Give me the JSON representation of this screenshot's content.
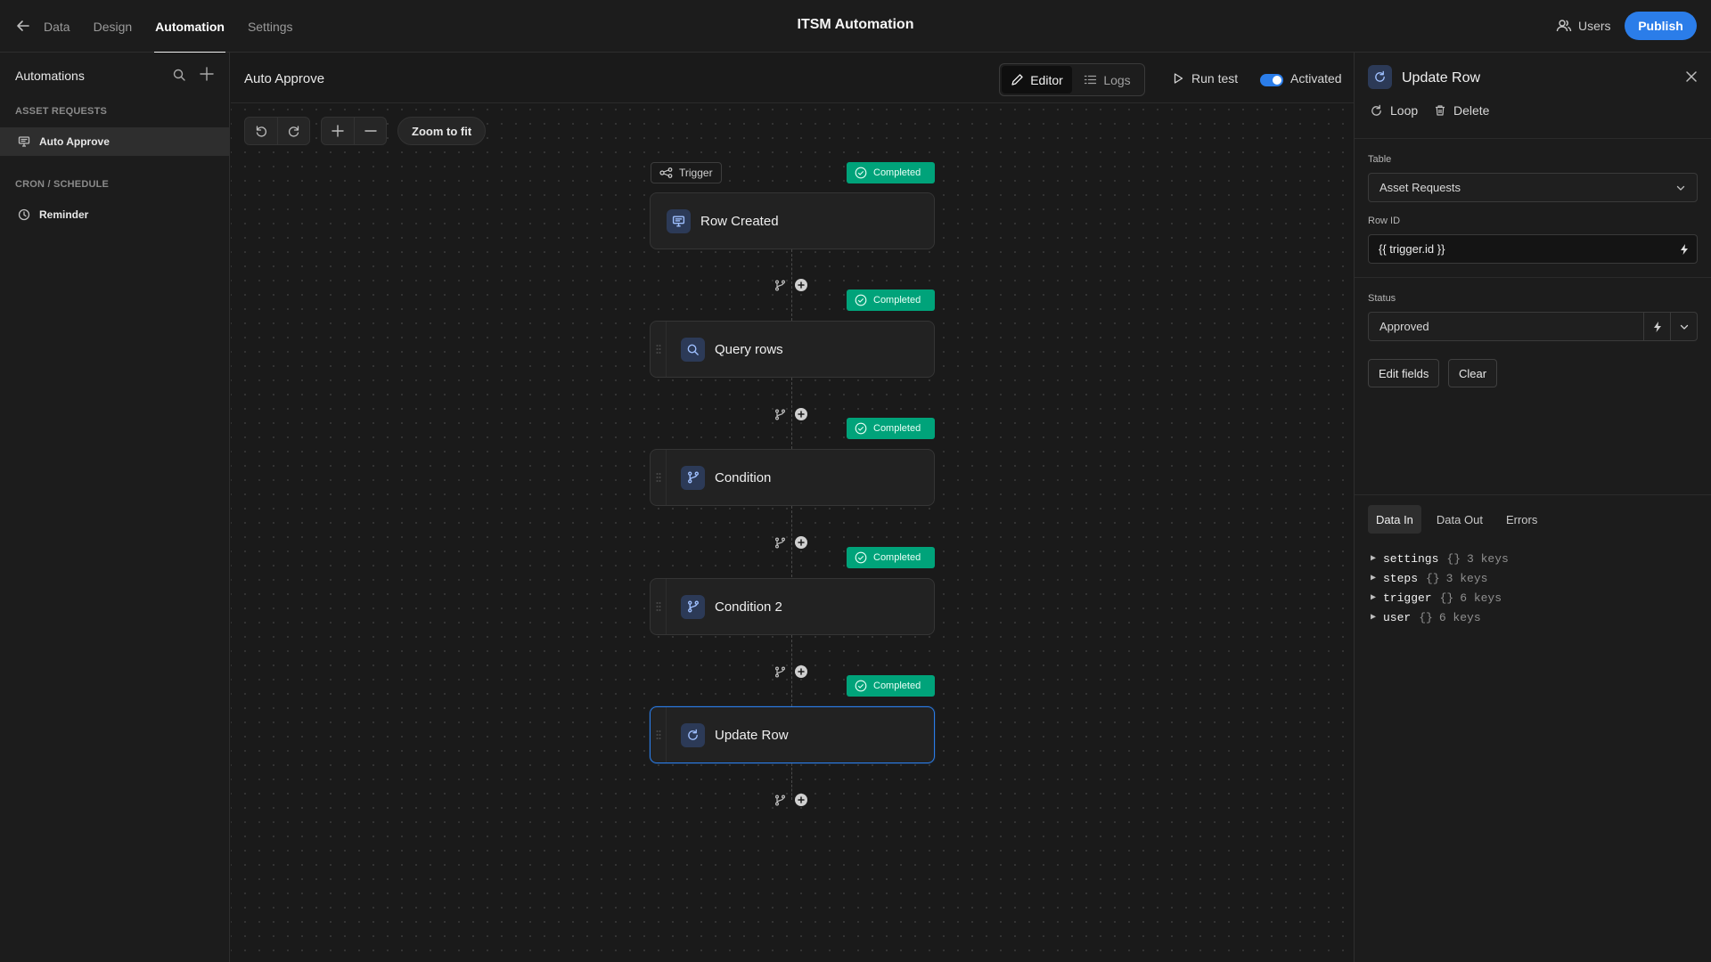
{
  "app": {
    "title": "ITSM Automation",
    "nav": [
      {
        "label": "Data"
      },
      {
        "label": "Design"
      },
      {
        "label": "Automation"
      },
      {
        "label": "Settings"
      }
    ],
    "users_label": "Users",
    "publish_label": "Publish",
    "accent_color": "#2b7de9",
    "success_color": "#00a37a"
  },
  "sidebar": {
    "title": "Automations",
    "sections": [
      {
        "heading": "ASSET REQUESTS",
        "items": [
          {
            "label": "Auto Approve",
            "icon": "table-icon",
            "active": true
          }
        ]
      },
      {
        "heading": "CRON / SCHEDULE",
        "items": [
          {
            "label": "Reminder",
            "icon": "clock-icon",
            "active": false
          }
        ]
      }
    ]
  },
  "canvas": {
    "automation_name": "Auto Approve",
    "editor_label": "Editor",
    "logs_label": "Logs",
    "run_test_label": "Run test",
    "activated_label": "Activated",
    "activated": true,
    "zoom_fit_label": "Zoom to fit",
    "trigger_label": "Trigger",
    "steps": [
      {
        "label": "Row Created",
        "status": "Completed",
        "icon": "table-icon"
      },
      {
        "label": "Query rows",
        "status": "Completed",
        "icon": "search-icon"
      },
      {
        "label": "Condition",
        "status": "Completed",
        "icon": "branch-icon"
      },
      {
        "label": "Condition 2",
        "status": "Completed",
        "icon": "branch-icon"
      },
      {
        "label": "Update Row",
        "status": "Completed",
        "icon": "refresh-icon",
        "selected": true
      }
    ]
  },
  "panel": {
    "title": "Update Row",
    "loop_label": "Loop",
    "delete_label": "Delete",
    "table_label": "Table",
    "table_value": "Asset Requests",
    "row_id_label": "Row ID",
    "row_id_value": "{{ trigger.id }}",
    "status_label": "Status",
    "status_value": "Approved",
    "edit_fields_label": "Edit fields",
    "clear_label": "Clear",
    "data_tabs": [
      {
        "label": "Data In",
        "active": true
      },
      {
        "label": "Data Out",
        "active": false
      },
      {
        "label": "Errors",
        "active": false
      }
    ],
    "tree": [
      {
        "key": "settings",
        "type": "{}",
        "count": "3 keys"
      },
      {
        "key": "steps",
        "type": "{}",
        "count": "3 keys"
      },
      {
        "key": "trigger",
        "type": "{}",
        "count": "6 keys"
      },
      {
        "key": "user",
        "type": "{}",
        "count": "6 keys"
      }
    ]
  }
}
